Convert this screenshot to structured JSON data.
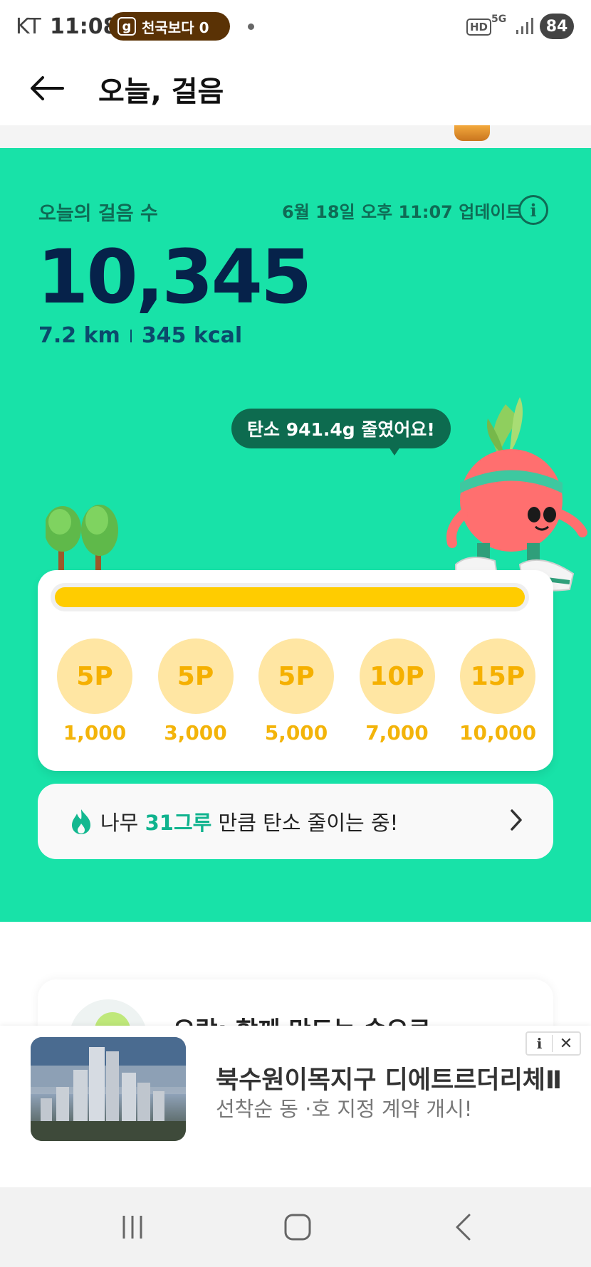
{
  "status_bar": {
    "carrier": "KT",
    "time": "11:08",
    "notification": "천국보다 0",
    "notification_icon": "g",
    "network_hd": "HD",
    "network_5g": "5G",
    "battery": "84"
  },
  "header": {
    "title": "오늘, 걸음"
  },
  "steps": {
    "label": "오늘의 걸음 수",
    "update_text": "6월 18일 오후 11:07 업데이트",
    "count": "10,345",
    "distance": "7.2 km",
    "calories": "345 kcal",
    "carbon_bubble": "탄소 941.4g 줄였어요!",
    "progress": 1.0
  },
  "rewards": [
    {
      "points": "5P",
      "goal": "1,000"
    },
    {
      "points": "5P",
      "goal": "3,000"
    },
    {
      "points": "5P",
      "goal": "5,000"
    },
    {
      "points": "10P",
      "goal": "7,000"
    },
    {
      "points": "15P",
      "goal": "10,000"
    }
  ],
  "tree_banner": {
    "prefix": "나무 ",
    "highlight": "31그루",
    "suffix": " 만큼 탄소 줄이는 중!"
  },
  "lower_card": {
    "title": "오락: 함께 만드는 숲으로"
  },
  "ad": {
    "title": "북수원이목지구 디에트르더리체Ⅱ",
    "subtitle": "선착순 동 ·호 지정 계약 개시!",
    "info_label": "i",
    "close_label": "✕"
  },
  "colors": {
    "panel_green": "#18e2a8",
    "step_navy": "#06224a",
    "progress_yellow": "#ffcc00",
    "coin_bg": "#ffe6a3",
    "highlight_teal": "#10b38e"
  }
}
